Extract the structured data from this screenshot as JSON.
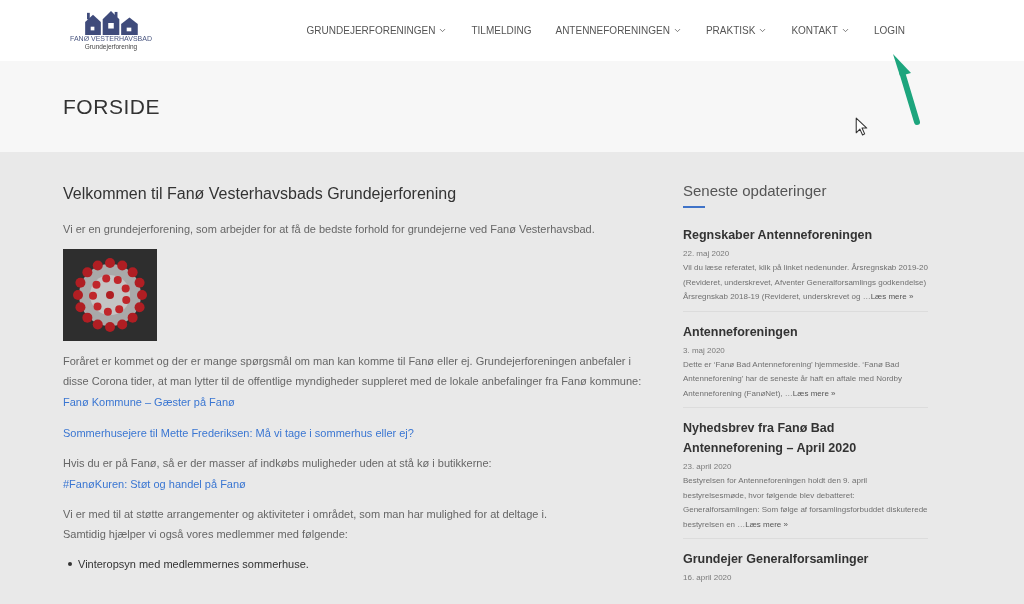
{
  "header": {
    "logo": {
      "title": "FANØ VESTERHAVSBAD",
      "subtitle": "Grundejerforening"
    },
    "nav": [
      {
        "label": "GRUNDEJERFORENINGEN",
        "dropdown": true
      },
      {
        "label": "TILMELDING",
        "dropdown": false
      },
      {
        "label": "ANTENNEFORENINGEN",
        "dropdown": true
      },
      {
        "label": "PRAKTISK",
        "dropdown": true
      },
      {
        "label": "KONTAKT",
        "dropdown": true
      },
      {
        "label": "LOGIN",
        "dropdown": false
      }
    ]
  },
  "page_title": "FORSIDE",
  "content": {
    "heading": "Velkommen til Fanø Vesterhavsbads Grundejerforening",
    "blocks": [
      {
        "kind": "paragraph",
        "lines": [
          {
            "kind": "text",
            "text": "Vi er en grundejerforening, som arbejder for at få de bedste forhold for grundejerne ved Fanø Vesterhavsbad."
          }
        ]
      },
      {
        "kind": "image"
      },
      {
        "kind": "paragraph",
        "lines": [
          {
            "kind": "text",
            "text": "Foråret er kommet og der er mange spørgsmål om man kan komme til Fanø eller ej. Grundejerforeningen anbefaler i disse Corona tider, at man lytter til de offentlige myndigheder suppleret med de lokale anbefalinger fra Fanø kommune:"
          },
          {
            "kind": "link",
            "text": "Fanø Kommune – Gæster på Fanø"
          }
        ]
      },
      {
        "kind": "paragraph",
        "lines": [
          {
            "kind": "link",
            "text": "Sommerhusejere til Mette Frederiksen: Må vi tage i sommerhus eller ej?"
          }
        ]
      },
      {
        "kind": "paragraph",
        "lines": [
          {
            "kind": "text",
            "text": "Hvis du er på Fanø, så er der masser af indkøbs muligheder uden at stå kø i butikkerne:"
          },
          {
            "kind": "link",
            "text": "#FanøKuren: Støt og handel på Fanø"
          }
        ]
      },
      {
        "kind": "paragraph",
        "lines": [
          {
            "kind": "text",
            "text": "Vi er med til at støtte arrangementer og aktiviteter i området, som man har mulighed for at deltage i."
          },
          {
            "kind": "text",
            "text": "Samtidig hjælper vi også vores medlemmer med følgende:"
          }
        ]
      },
      {
        "kind": "list",
        "items": [
          "Vinteropsyn med medlemmernes sommerhuse."
        ]
      }
    ]
  },
  "sidebar": {
    "title": "Seneste opdateringer",
    "posts": [
      {
        "title": "Regnskaber Antenneforeningen",
        "date": "22. maj 2020",
        "excerpt": "Vil du læse referatet, klik på linket nedenunder. Årsregnskab 2019-20 (Revideret, underskrevet, Afventer Generalforsamlings godkendelse) Årsregnskab 2018-19 (Revideret, underskrevet og …",
        "read_more": "Læs mere »"
      },
      {
        "title": "Antenneforeningen",
        "date": "3. maj 2020",
        "excerpt": "Dette er ‘Fanø Bad Antenneforening’ hjemmeside. ‘Fanø Bad Antenneforening’ har de seneste år haft en aftale med Nordby Antenneforening (FanøNet), …",
        "read_more": "Læs mere »"
      },
      {
        "title": "Nyhedsbrev fra Fanø Bad Antenneforening – April 2020",
        "date": "23. april 2020",
        "excerpt": "Bestyrelsen for Antenneforeningen holdt den 9. april bestyrelsesmøde, hvor følgende blev debatteret: Generalforsamlingen: Som følge af forsamlingsforbuddet diskuterede bestyrelsen en …",
        "read_more": "Læs mere »"
      },
      {
        "title": "Grundejer Generalforsamlinger",
        "date": "16. april 2020"
      }
    ]
  }
}
